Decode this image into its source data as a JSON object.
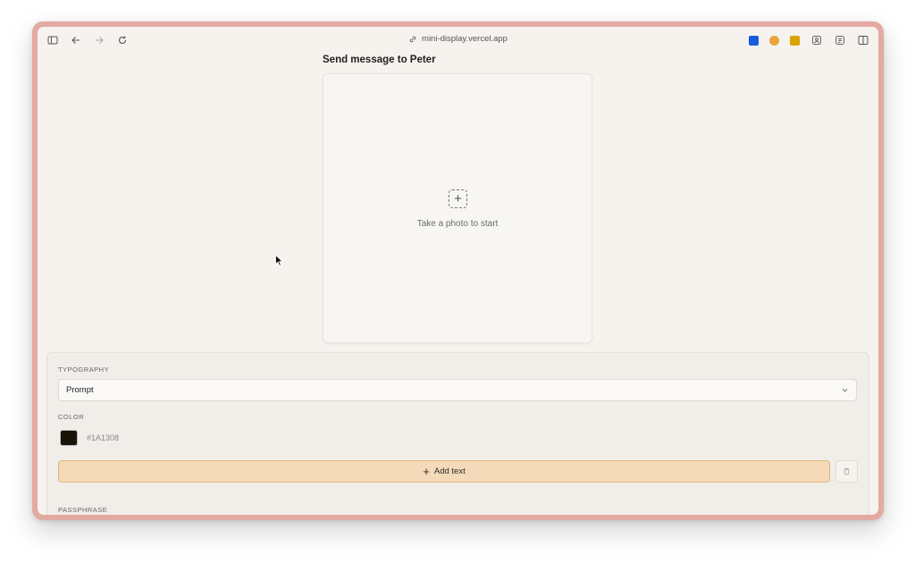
{
  "browser": {
    "url": "mini-display.vercel.app",
    "extensions": [
      {
        "name": "bitwarden-icon",
        "color": "#175ddc"
      },
      {
        "name": "extension-2-icon",
        "color": "#e8a53a"
      },
      {
        "name": "extension-3-icon",
        "color": "#d9a400"
      },
      {
        "name": "reader-icon",
        "color": "#666666"
      },
      {
        "name": "notes-icon",
        "color": "#666666"
      },
      {
        "name": "split-view-icon",
        "color": "#666666"
      }
    ]
  },
  "page": {
    "title": "Send message to Peter",
    "photo_hint": "Take a photo to start"
  },
  "typography": {
    "label": "TYPOGRAPHY",
    "selected": "Prompt"
  },
  "color": {
    "label": "COLOR",
    "value": "#1A1308"
  },
  "actions": {
    "add_text_label": "Add text"
  },
  "passphrase": {
    "label": "PASSPHRASE"
  },
  "theme": {
    "frame": "#e3aaa2",
    "background": "#f6f3ef",
    "accent": "#f4dab8",
    "accent_border": "#e6b680"
  }
}
